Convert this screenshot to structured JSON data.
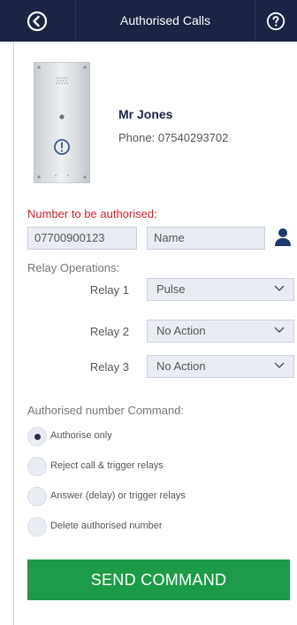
{
  "header": {
    "title": "Authorised Calls"
  },
  "contact": {
    "name": "Mr Jones",
    "phone": "Phone: 07540293702"
  },
  "form": {
    "number_label": "Number to be authorised:",
    "number_value": "07700900123",
    "name_placeholder": "Name",
    "relay_label": "Relay Operations:",
    "relays": [
      {
        "label": "Relay 1",
        "value": "Pulse"
      },
      {
        "label": "Relay 2",
        "value": "No Action"
      },
      {
        "label": "Relay 3",
        "value": "No Action"
      }
    ],
    "command_label": "Authorised number Command:",
    "commands": [
      {
        "label": "Authorise only",
        "selected": true
      },
      {
        "label": "Reject call & trigger relays",
        "selected": false
      },
      {
        "label": "Answer (delay) or trigger relays",
        "selected": false
      },
      {
        "label": "Delete authorised number",
        "selected": false
      }
    ],
    "send_label": "SEND COMMAND"
  },
  "colors": {
    "header_bg": "#1b2443",
    "accent_red": "#d4212f",
    "send_green": "#1e9b48",
    "field_bg": "#e9edf3"
  },
  "icons": [
    "back-icon",
    "help-icon",
    "user-icon",
    "chevron-down-icon",
    "intercom-panel-image"
  ]
}
